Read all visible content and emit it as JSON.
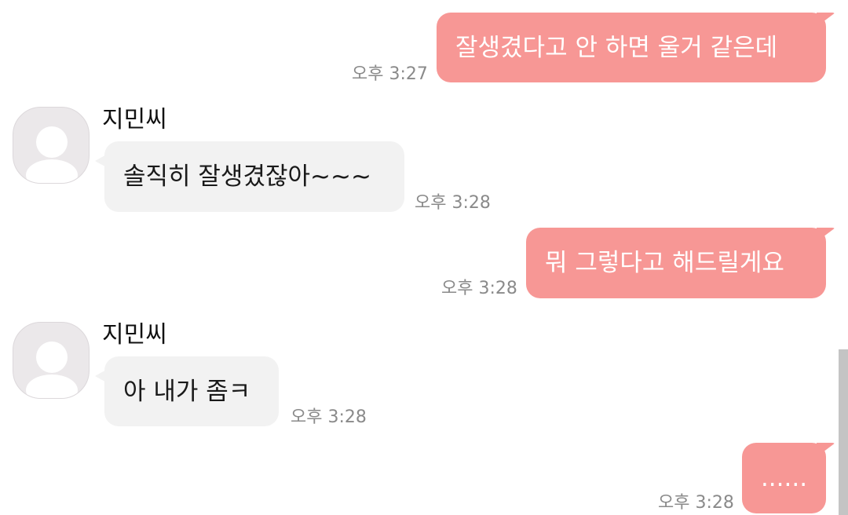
{
  "messages": [
    {
      "direction": "out",
      "text": "잘생겼다고 안 하면 울거 같은데",
      "time": "오후 3:27"
    },
    {
      "direction": "in",
      "sender": "지민씨",
      "text": "솔직히 잘생겼잖아~~~",
      "time": "오후 3:28"
    },
    {
      "direction": "out",
      "text": "뭐 그렇다고 해드릴게요",
      "time": "오후 3:28"
    },
    {
      "direction": "in",
      "sender": "지민씨",
      "text": "아 내가 좀ㅋ",
      "time": "오후 3:28"
    },
    {
      "direction": "out",
      "text": "......",
      "time": "오후 3:28"
    }
  ],
  "colors": {
    "outgoing_bubble": "#f79795",
    "incoming_bubble": "#f2f2f2",
    "timestamp": "#8a8a8a",
    "avatar_bg": "#ebe8ea"
  },
  "icons": {
    "avatar": "default-profile-icon"
  }
}
